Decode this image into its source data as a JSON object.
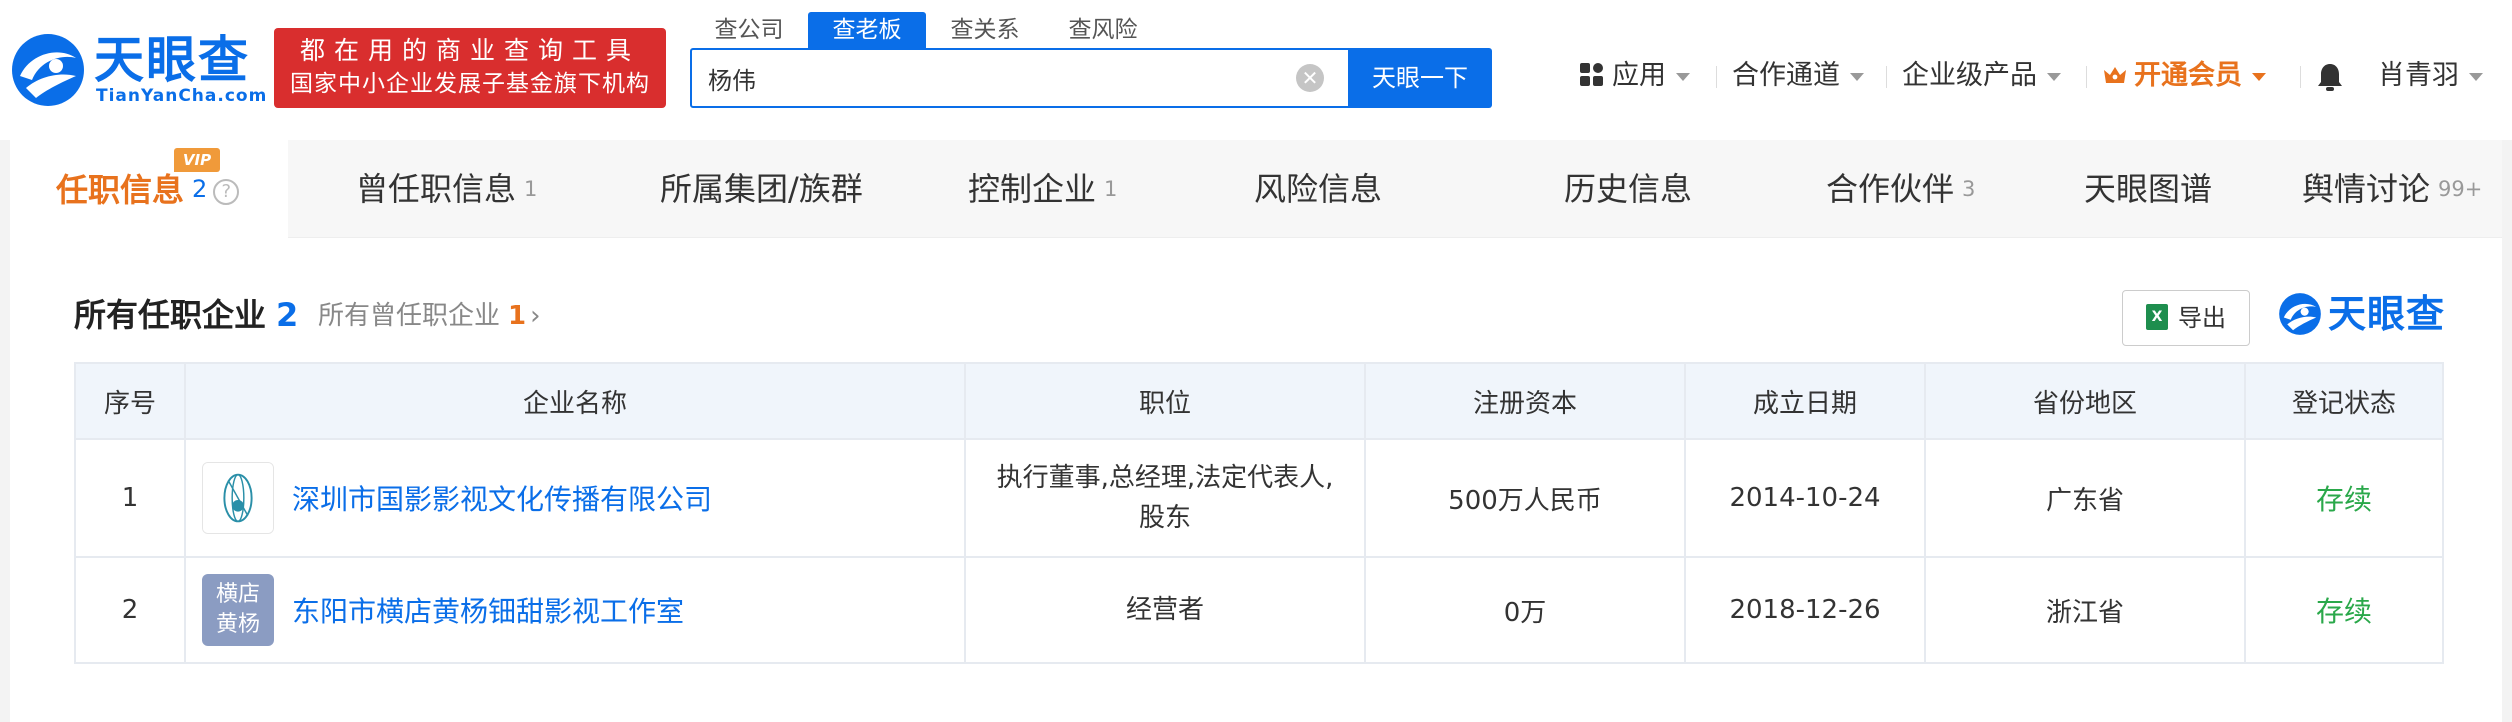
{
  "brand": {
    "name_cn": "天眼查",
    "name_en": "TianYanCha.com"
  },
  "slogan": {
    "line1": "都在用的商业查询工具",
    "line2": "国家中小企业发展子基金旗下机构"
  },
  "search": {
    "tabs": [
      "查公司",
      "查老板",
      "查关系",
      "查风险"
    ],
    "active_tab": "查老板",
    "value": "杨伟",
    "button": "天眼一下"
  },
  "topnav": {
    "apps": "应用",
    "partner_channel": "合作通道",
    "enterprise_products": "企业级产品",
    "vip": "开通会员",
    "user": "肖青羽"
  },
  "tabs": [
    {
      "label": "任职信息",
      "count": "2",
      "vip": "VIP"
    },
    {
      "label": "曾任职信息",
      "count": "1"
    },
    {
      "label": "所属集团/族群",
      "count": ""
    },
    {
      "label": "控制企业",
      "count": "1"
    },
    {
      "label": "风险信息",
      "count": ""
    },
    {
      "label": "历史信息",
      "count": ""
    },
    {
      "label": "合作伙伴",
      "count": "3"
    },
    {
      "label": "天眼图谱",
      "count": ""
    },
    {
      "label": "舆情讨论",
      "count": "99+"
    }
  ],
  "section": {
    "title": "所有任职企业",
    "count": "2",
    "former_label": "所有曾任职企业",
    "former_count": "1",
    "export_label": "导出",
    "brand_mark": "天眼查"
  },
  "table": {
    "headers": [
      "序号",
      "企业名称",
      "职位",
      "注册资本",
      "成立日期",
      "省份地区",
      "登记状态"
    ],
    "rows": [
      {
        "idx": "1",
        "name": "深圳市国影影视文化传播有限公司",
        "logo_text": "",
        "position_l1": "执行董事,总经理,法定代表人,",
        "position_l2": "股东",
        "capital": "500万人民币",
        "date": "2014-10-24",
        "region": "广东省",
        "status": "存续"
      },
      {
        "idx": "2",
        "name": "东阳市横店黄杨钿甜影视工作室",
        "logo_text_l1": "横店",
        "logo_text_l2": "黄杨",
        "position_l1": "经营者",
        "position_l2": "",
        "capital": "0万",
        "date": "2018-12-26",
        "region": "浙江省",
        "status": "存续"
      }
    ]
  },
  "colors": {
    "brand_blue": "#0a6ee8",
    "accent_orange": "#e8721d",
    "slogan_red": "#d92e2e",
    "status_green": "#2aa84a"
  }
}
